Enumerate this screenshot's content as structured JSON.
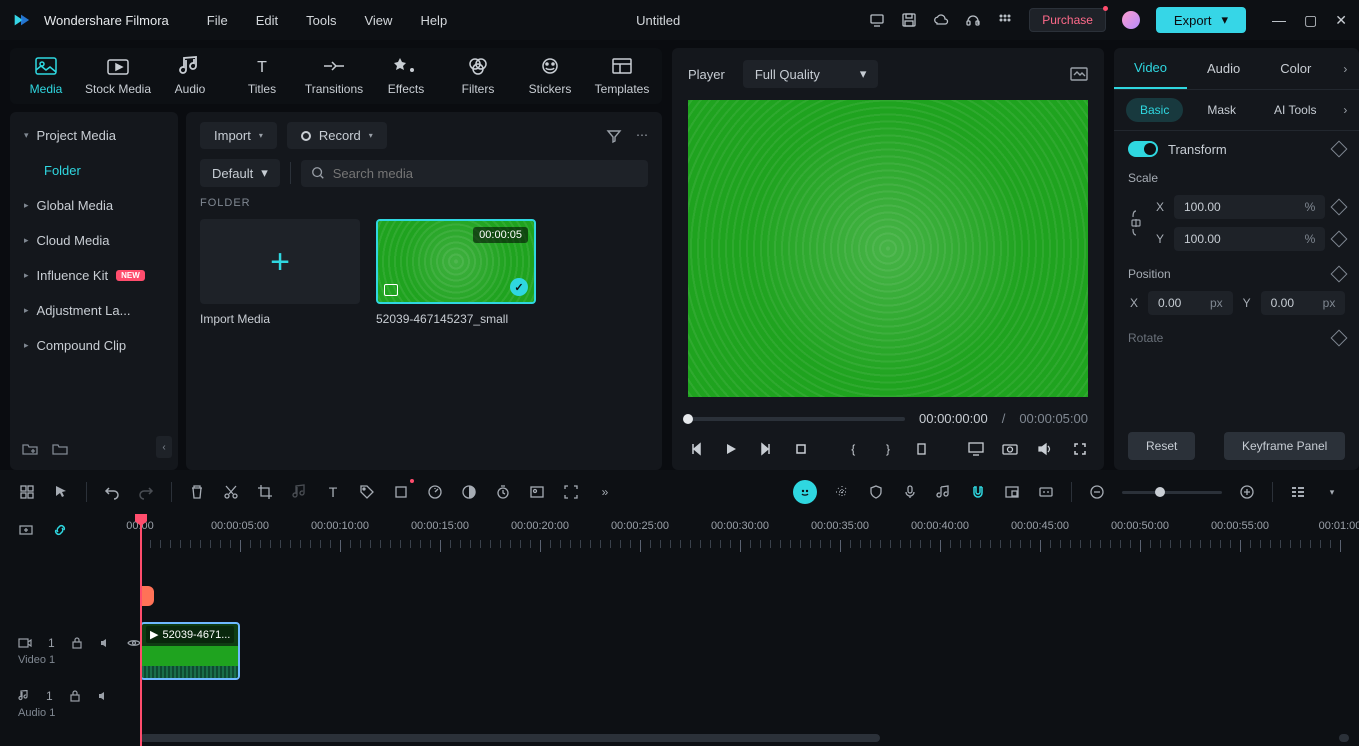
{
  "app_name": "Wondershare Filmora",
  "menus": [
    "File",
    "Edit",
    "Tools",
    "View",
    "Help"
  ],
  "doc_title": "Untitled",
  "purchase_label": "Purchase",
  "export_label": "Export",
  "categories": [
    {
      "label": "Media",
      "active": true
    },
    {
      "label": "Stock Media"
    },
    {
      "label": "Audio"
    },
    {
      "label": "Titles"
    },
    {
      "label": "Transitions"
    },
    {
      "label": "Effects"
    },
    {
      "label": "Filters"
    },
    {
      "label": "Stickers"
    },
    {
      "label": "Templates"
    }
  ],
  "sidebar": {
    "items": [
      {
        "label": "Project Media",
        "parent": true
      },
      {
        "label": "Folder",
        "child": true,
        "active": true
      },
      {
        "label": "Global Media"
      },
      {
        "label": "Cloud Media"
      },
      {
        "label": "Influence Kit",
        "badge": "NEW"
      },
      {
        "label": "Adjustment La..."
      },
      {
        "label": "Compound Clip"
      }
    ]
  },
  "media_area": {
    "import_label": "Import",
    "record_label": "Record",
    "sort_label": "Default",
    "search_placeholder": "Search media",
    "folder_label": "FOLDER",
    "import_media_label": "Import Media",
    "clip": {
      "duration": "00:00:05",
      "name": "52039-467145237_small"
    }
  },
  "player": {
    "label": "Player",
    "quality": "Full Quality",
    "current": "00:00:00:00",
    "total": "00:00:05:00",
    "sep": "/"
  },
  "inspector": {
    "tabs": [
      "Video",
      "Audio",
      "Color"
    ],
    "subtabs": [
      "Basic",
      "Mask",
      "AI Tools"
    ],
    "transform_label": "Transform",
    "scale_label": "Scale",
    "scale_x": "100.00",
    "scale_y": "100.00",
    "scale_unit": "%",
    "x_label": "X",
    "y_label": "Y",
    "position_label": "Position",
    "pos_x": "0.00",
    "pos_y": "0.00",
    "pos_unit": "px",
    "rotate_label": "Rotate",
    "reset_label": "Reset",
    "keyframe_label": "Keyframe Panel"
  },
  "timeline": {
    "ticks": [
      "00:00",
      "00:00:05:00",
      "00:00:10:00",
      "00:00:15:00",
      "00:00:20:00",
      "00:00:25:00",
      "00:00:30:00",
      "00:00:35:00",
      "00:00:40:00",
      "00:00:45:00",
      "00:00:50:00",
      "00:00:55:00",
      "00:01:00"
    ],
    "video_track": "Video 1",
    "audio_track": "Audio 1",
    "clip_title": "52039-4671...",
    "track_index": "1"
  }
}
